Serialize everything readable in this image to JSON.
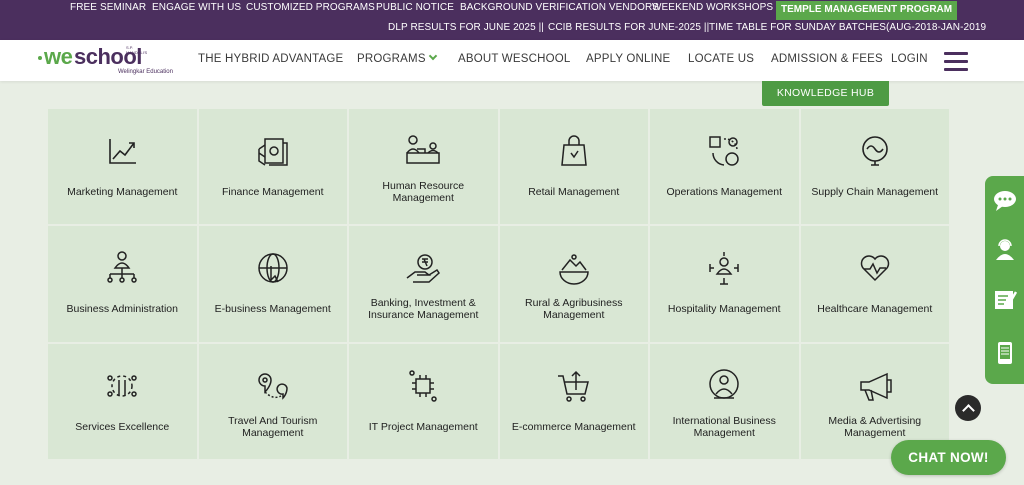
{
  "topbar": {
    "row1": [
      "FREE SEMINAR",
      "ENGAGE WITH US",
      "CUSTOMIZED PROGRAMS",
      "PUBLIC NOTICE",
      "BACKGROUND VERIFICATION VENDORS",
      "WEEKEND WORKSHOPS"
    ],
    "temple": "TEMPLE MANAGEMENT PROGRAM",
    "row2": [
      "DLP RESULTS FOR JUNE 2025 ||",
      "CCIB RESULTS FOR JUNE-2025 ||",
      "TIME TABLE FOR SUNDAY BATCHES(AUG-2018-JAN-2019"
    ]
  },
  "logo": {
    "we": "we",
    "school": "school",
    "sup": "S.P. MANDALI'S",
    "sub": "Welingkar Education"
  },
  "nav": {
    "items": [
      "THE HYBRID ADVANTAGE",
      "PROGRAMS",
      "ABOUT WESCHOOL",
      "APPLY ONLINE",
      "LOCATE US",
      "ADMISSION & FEES",
      "LOGIN"
    ]
  },
  "knowledge_hub": "KNOWLEDGE HUB",
  "programs": [
    {
      "label": "Marketing Management",
      "icon": "chart-trend-icon"
    },
    {
      "label": "Finance Management",
      "icon": "money-icon"
    },
    {
      "label": "Human Resource Management",
      "icon": "desk-people-icon"
    },
    {
      "label": "Retail Management",
      "icon": "shopping-bag-icon"
    },
    {
      "label": "Operations Management",
      "icon": "cycle-icon"
    },
    {
      "label": "Supply Chain Management",
      "icon": "wave-circle-icon"
    },
    {
      "label": "Business Administration",
      "icon": "org-person-icon"
    },
    {
      "label": "E-business Management",
      "icon": "globe-click-icon"
    },
    {
      "label": "Banking, Investment & Insurance Management",
      "icon": "hand-rupee-icon"
    },
    {
      "label": "Rural & Agribusiness Management",
      "icon": "landscape-icon"
    },
    {
      "label": "Hospitality Management",
      "icon": "concierge-icon"
    },
    {
      "label": "Healthcare Management",
      "icon": "heart-pulse-icon"
    },
    {
      "label": "Services Excellence",
      "icon": "tools-icon"
    },
    {
      "label": "Travel And Tourism Management",
      "icon": "map-pin-icon"
    },
    {
      "label": "IT Project Management",
      "icon": "chip-icon"
    },
    {
      "label": "E-commerce Management",
      "icon": "cart-upload-icon"
    },
    {
      "label": "International Business Management",
      "icon": "globe-person-icon"
    },
    {
      "label": "Media & Advertising Management",
      "icon": "megaphone-icon"
    }
  ],
  "chat_label": "CHAT NOW!",
  "colors": {
    "purple": "#4b2f5e",
    "green": "#5ba84b",
    "tile": "#d9e7d4"
  }
}
